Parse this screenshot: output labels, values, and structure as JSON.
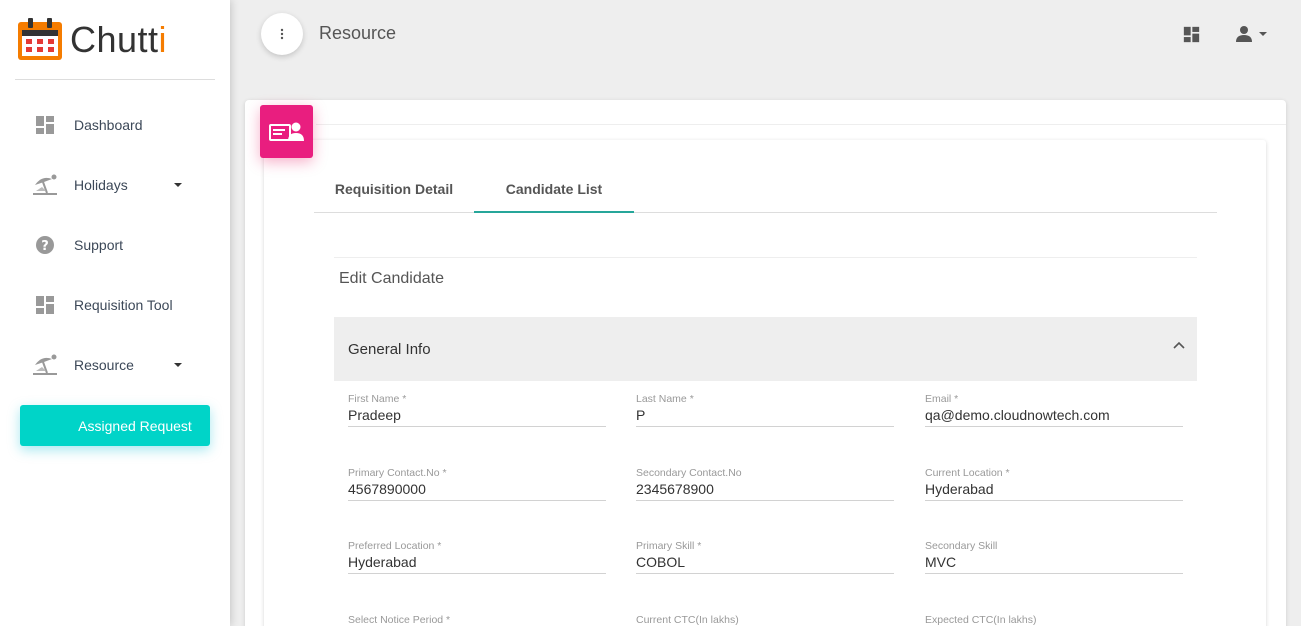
{
  "app": {
    "logo_text_main": "Chutt",
    "logo_text_accent": "i"
  },
  "sidebar": {
    "items": [
      {
        "label": "Dashboard",
        "icon": "dashboard-icon",
        "has_caret": false
      },
      {
        "label": "Holidays",
        "icon": "beach-icon",
        "has_caret": true
      },
      {
        "label": "Support",
        "icon": "help-icon",
        "has_caret": false
      },
      {
        "label": "Requisition Tool",
        "icon": "dashboard-icon",
        "has_caret": false
      },
      {
        "label": "Resource",
        "icon": "beach-icon",
        "has_caret": true
      }
    ],
    "active_button": "Assigned Request"
  },
  "topbar": {
    "title": "Resource"
  },
  "tabs": [
    {
      "label": "Requisition Detail",
      "active": false
    },
    {
      "label": "Candidate List",
      "active": true
    }
  ],
  "section": {
    "title": "Edit Candidate"
  },
  "accordion": {
    "title": "General Info"
  },
  "form": {
    "first_name": {
      "label": "First Name *",
      "value": "Pradeep"
    },
    "last_name": {
      "label": "Last Name *",
      "value": "P"
    },
    "email": {
      "label": "Email *",
      "value": "qa@demo.cloudnowtech.com"
    },
    "primary_contact": {
      "label": "Primary Contact.No *",
      "value": "4567890000"
    },
    "secondary_contact": {
      "label": "Secondary Contact.No",
      "value": "2345678900"
    },
    "current_location": {
      "label": "Current Location *",
      "value": "Hyderabad"
    },
    "preferred_location": {
      "label": "Preferred Location *",
      "value": "Hyderabad"
    },
    "primary_skill": {
      "label": "Primary Skill *",
      "value": "COBOL"
    },
    "secondary_skill": {
      "label": "Secondary Skill",
      "value": "MVC"
    },
    "notice_period": {
      "label": "Select Notice Period *",
      "value": ""
    },
    "current_ctc": {
      "label": "Current CTC(In lakhs)",
      "value": ""
    },
    "expected_ctc": {
      "label": "Expected CTC(In lakhs)",
      "value": ""
    }
  },
  "colors": {
    "accent_teal": "#00d4c8",
    "accent_pink": "#e91e7f",
    "tab_underline": "#26a69a",
    "brand_orange": "#f57c00"
  }
}
